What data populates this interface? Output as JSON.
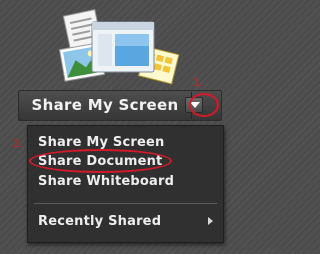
{
  "share_pod": {
    "button_label": "Share My Screen",
    "dropdown_icon": "triangle-down-icon",
    "pod_icon": "share-documents-icon"
  },
  "annotations": {
    "step1": "1.",
    "step2": "2."
  },
  "menu": {
    "items": [
      {
        "label": "Share My Screen"
      },
      {
        "label": "Share Document"
      },
      {
        "label": "Share Whiteboard"
      },
      {
        "label": "Recently Shared",
        "has_submenu": true
      }
    ]
  },
  "colors": {
    "background": "#4c4c4c",
    "menu_background": "#303030",
    "menu_text": "#eeeeee",
    "annotation_red": "#d6192a"
  }
}
